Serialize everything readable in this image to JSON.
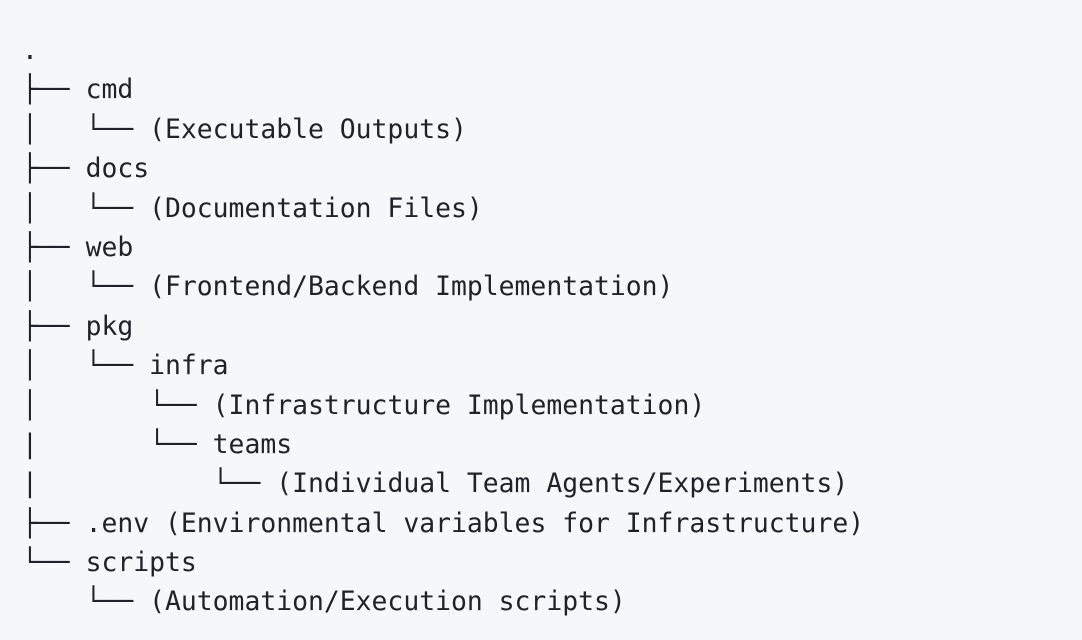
{
  "tree": {
    "lines": [
      {
        "prefix": ".",
        "name": "",
        "note": ""
      },
      {
        "prefix": "├── ",
        "name": "cmd",
        "note": ""
      },
      {
        "prefix": "│   └── ",
        "name": "",
        "note": "(Executable Outputs)"
      },
      {
        "prefix": "├── ",
        "name": "docs",
        "note": ""
      },
      {
        "prefix": "│   └── ",
        "name": "",
        "note": "(Documentation Files)"
      },
      {
        "prefix": "├── ",
        "name": "web",
        "note": ""
      },
      {
        "prefix": "│   └── ",
        "name": "",
        "note": "(Frontend/Backend Implementation)"
      },
      {
        "prefix": "├── ",
        "name": "pkg",
        "note": ""
      },
      {
        "prefix": "│   └── ",
        "name": "infra",
        "note": ""
      },
      {
        "prefix": "│       └── ",
        "name": "",
        "note": "(Infrastructure Implementation)"
      },
      {
        "prefix": "|       └── ",
        "name": "teams",
        "note": ""
      },
      {
        "prefix": "|           └── ",
        "name": "",
        "note": "(Individual Team Agents/Experiments)"
      },
      {
        "prefix": "├── ",
        "name": ".env",
        "note": " (Environmental variables for Infrastructure)"
      },
      {
        "prefix": "└── ",
        "name": "scripts",
        "note": ""
      },
      {
        "prefix": "    └── ",
        "name": "",
        "note": "(Automation/Execution scripts)"
      }
    ]
  }
}
